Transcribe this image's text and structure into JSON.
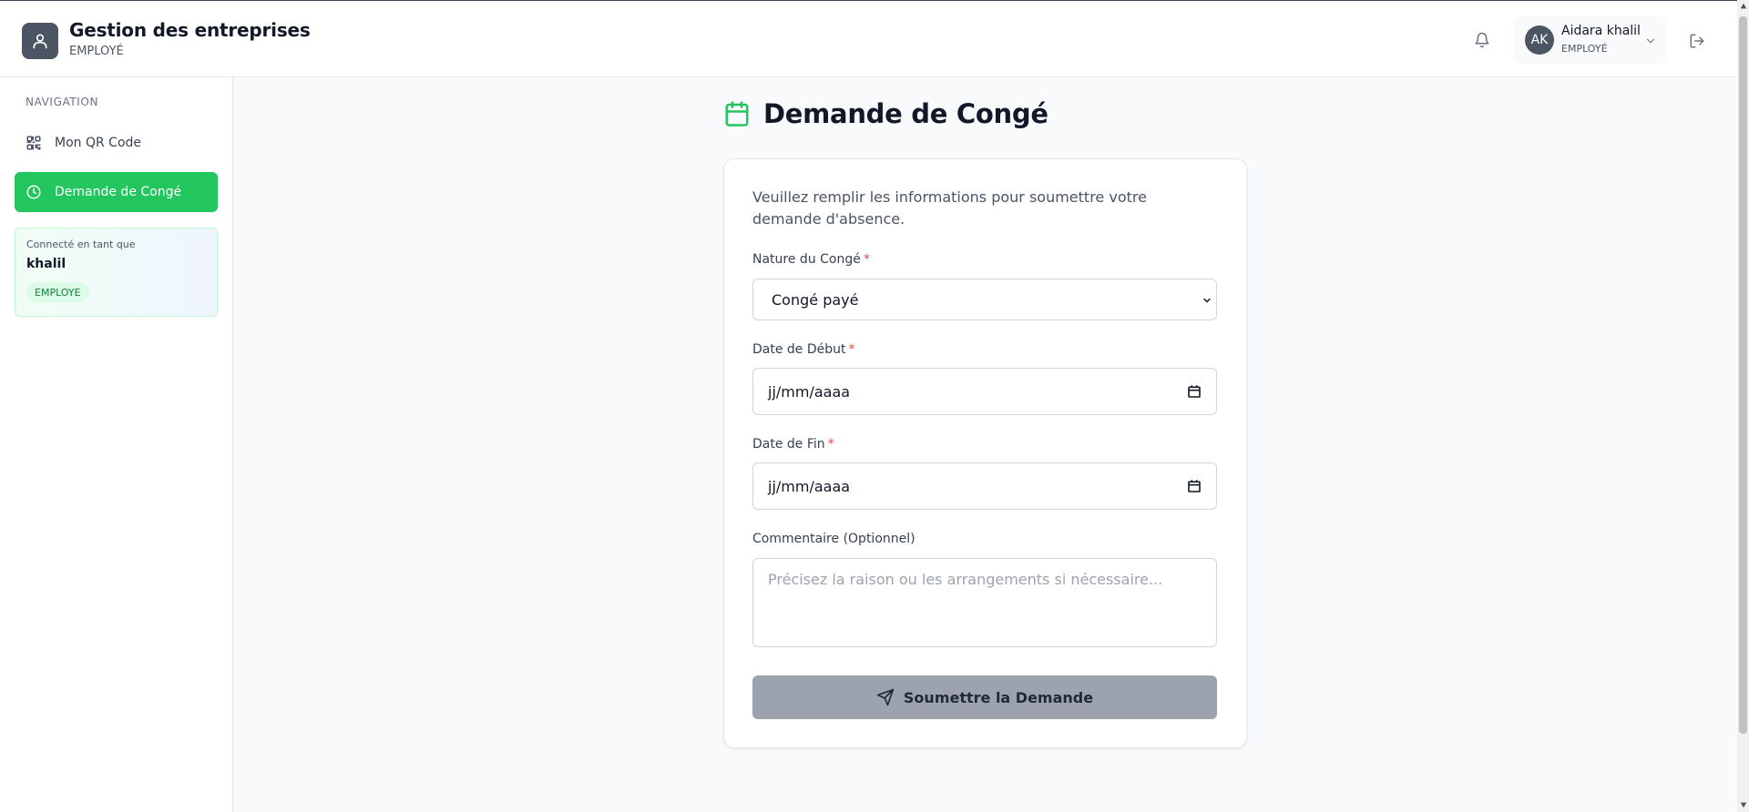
{
  "header": {
    "title": "Gestion des entreprises",
    "subtitle": "EMPLOYÉ",
    "user": {
      "initials": "AK",
      "name": "Aidara khalil",
      "role": "EMPLOYÉ"
    }
  },
  "sidebar": {
    "heading": "NAVIGATION",
    "items": [
      {
        "label": "Mon QR Code",
        "icon": "qr-code-icon",
        "active": false
      },
      {
        "label": "Demande de Congé",
        "icon": "clock-icon",
        "active": true
      }
    ],
    "user_card": {
      "label": "Connecté en tant que",
      "name": "khalil",
      "badge": "EMPLOYE"
    }
  },
  "main": {
    "title": "Demande de Congé",
    "intro": "Veuillez remplir les informations pour soumettre votre demande d'absence.",
    "form": {
      "type_label": "Nature du Congé",
      "type_value": "Congé payé",
      "start_label": "Date de Début",
      "start_value": "jj/mm/aaaa",
      "end_label": "Date de Fin",
      "end_value": "jj/mm/aaaa",
      "comment_label": "Commentaire (Optionnel)",
      "comment_placeholder": "Précisez la raison ou les arrangements si nécessaire...",
      "required_mark": "*",
      "submit_label": "Soumettre la Demande"
    }
  },
  "colors": {
    "accent": "#22c55e",
    "required": "#ef4444",
    "submit_disabled": "#9ca3af"
  }
}
